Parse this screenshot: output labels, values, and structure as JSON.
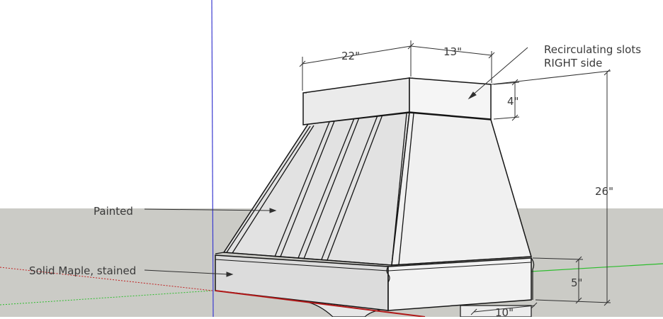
{
  "annotations": {
    "recirculating_line1": "Recirculating slots",
    "recirculating_line2": "RIGHT side",
    "painted": "Painted",
    "solid_maple": "Solid Maple, stained"
  },
  "dimensions": {
    "width_front": "22\"",
    "depth_side": "13\"",
    "top_band_height": "4\"",
    "overall_height": "26\"",
    "bottom_band_height": "5\"",
    "bottom_depth": "10\""
  },
  "colors": {
    "sky": "#ffffff",
    "ground": "#cbcbc6",
    "blue_axis": "#3b3bd0",
    "green_axis": "#2dbd2d",
    "red_axis": "#c02020",
    "face_front": "#e2e2e2",
    "face_side": "#f0f0f0",
    "edge": "#151515"
  }
}
